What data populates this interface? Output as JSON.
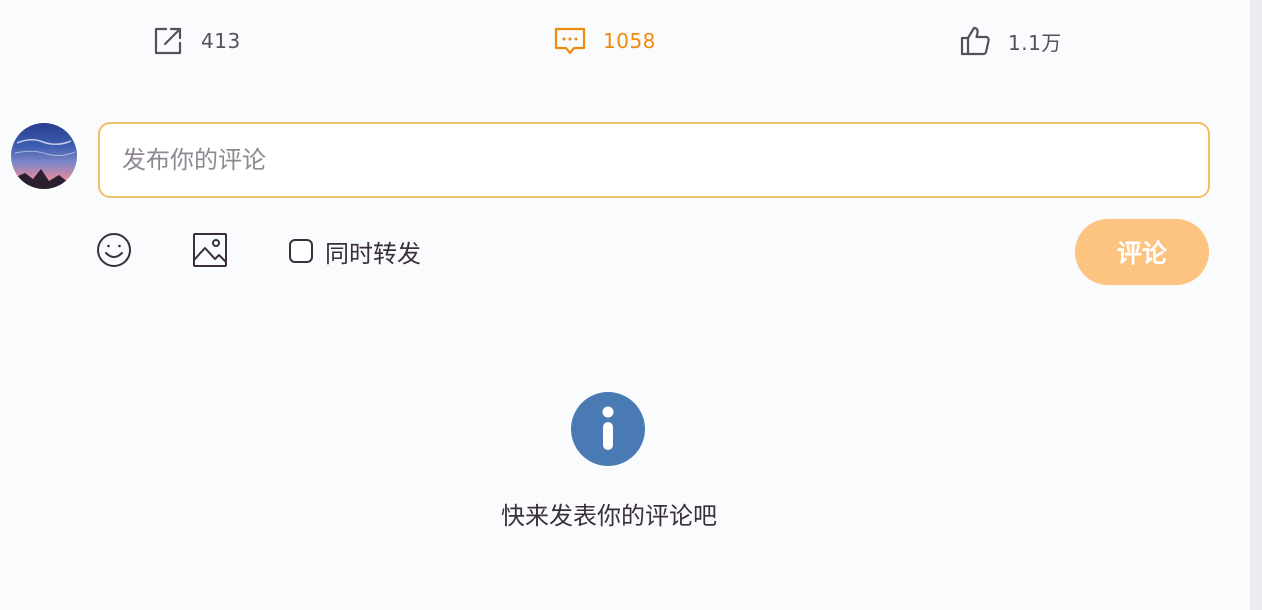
{
  "actions": {
    "repost": {
      "icon": "share-icon",
      "count": "413"
    },
    "comment": {
      "icon": "comment-icon",
      "count": "1058",
      "active_color": "#f08a0c"
    },
    "like": {
      "icon": "thumbs-up-icon",
      "count": "1.1万"
    }
  },
  "composer": {
    "avatar": "user-avatar",
    "placeholder": "发布你的评论",
    "value": "",
    "emoji_icon": "smiley-icon",
    "image_icon": "image-icon",
    "also_repost_label": "同时转发",
    "also_repost_checked": false,
    "submit_label": "评论",
    "submit_color": "#fcc381"
  },
  "empty_state": {
    "icon": "info-icon",
    "icon_color": "#4a7ab3",
    "message": "快来发表你的评论吧"
  }
}
